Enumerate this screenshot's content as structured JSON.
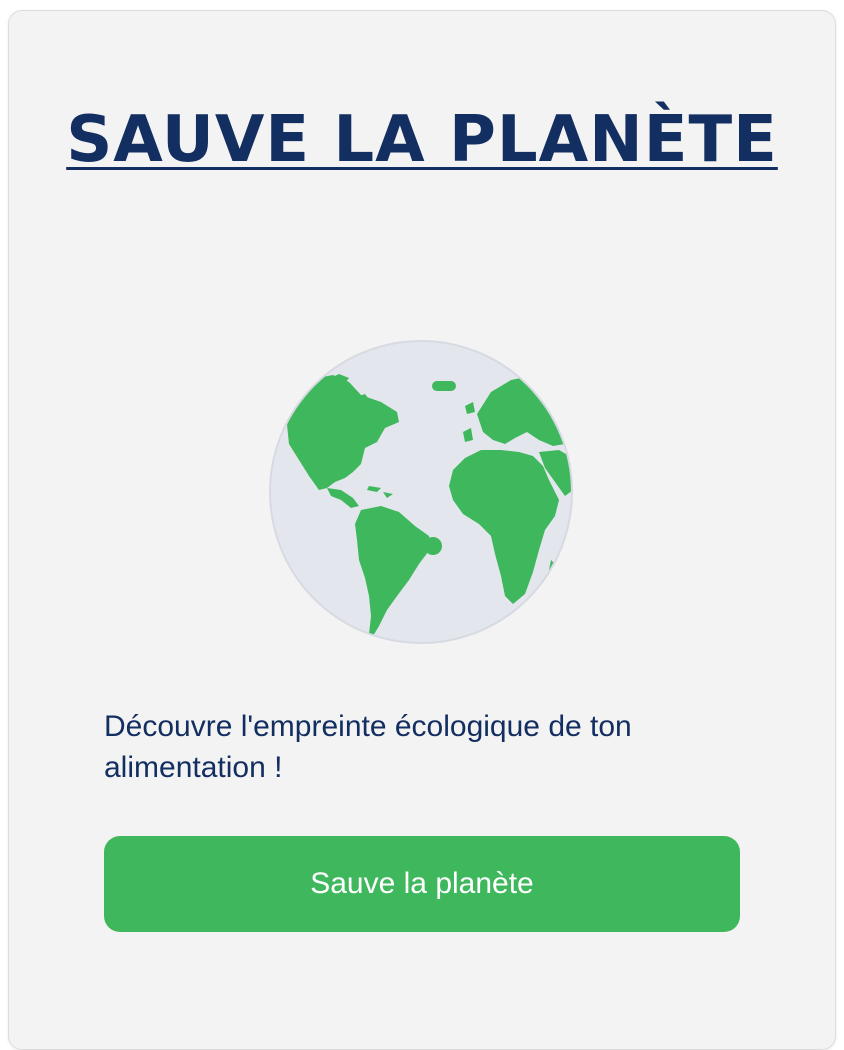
{
  "hero": {
    "title": "SAUVE LA PLANÈTE",
    "illustration_icon": "earth-globe-icon"
  },
  "content": {
    "description": "Découvre l'empreinte écologique de ton alimentation !"
  },
  "actions": {
    "cta_label": "Sauve la planète"
  },
  "colors": {
    "card_background": "#f3f3f3",
    "title_text": "#132e60",
    "globe_ocean": "#e3e6ec",
    "globe_land": "#3fb85d",
    "button_background": "#3fb85d",
    "button_text": "#ffffff"
  }
}
